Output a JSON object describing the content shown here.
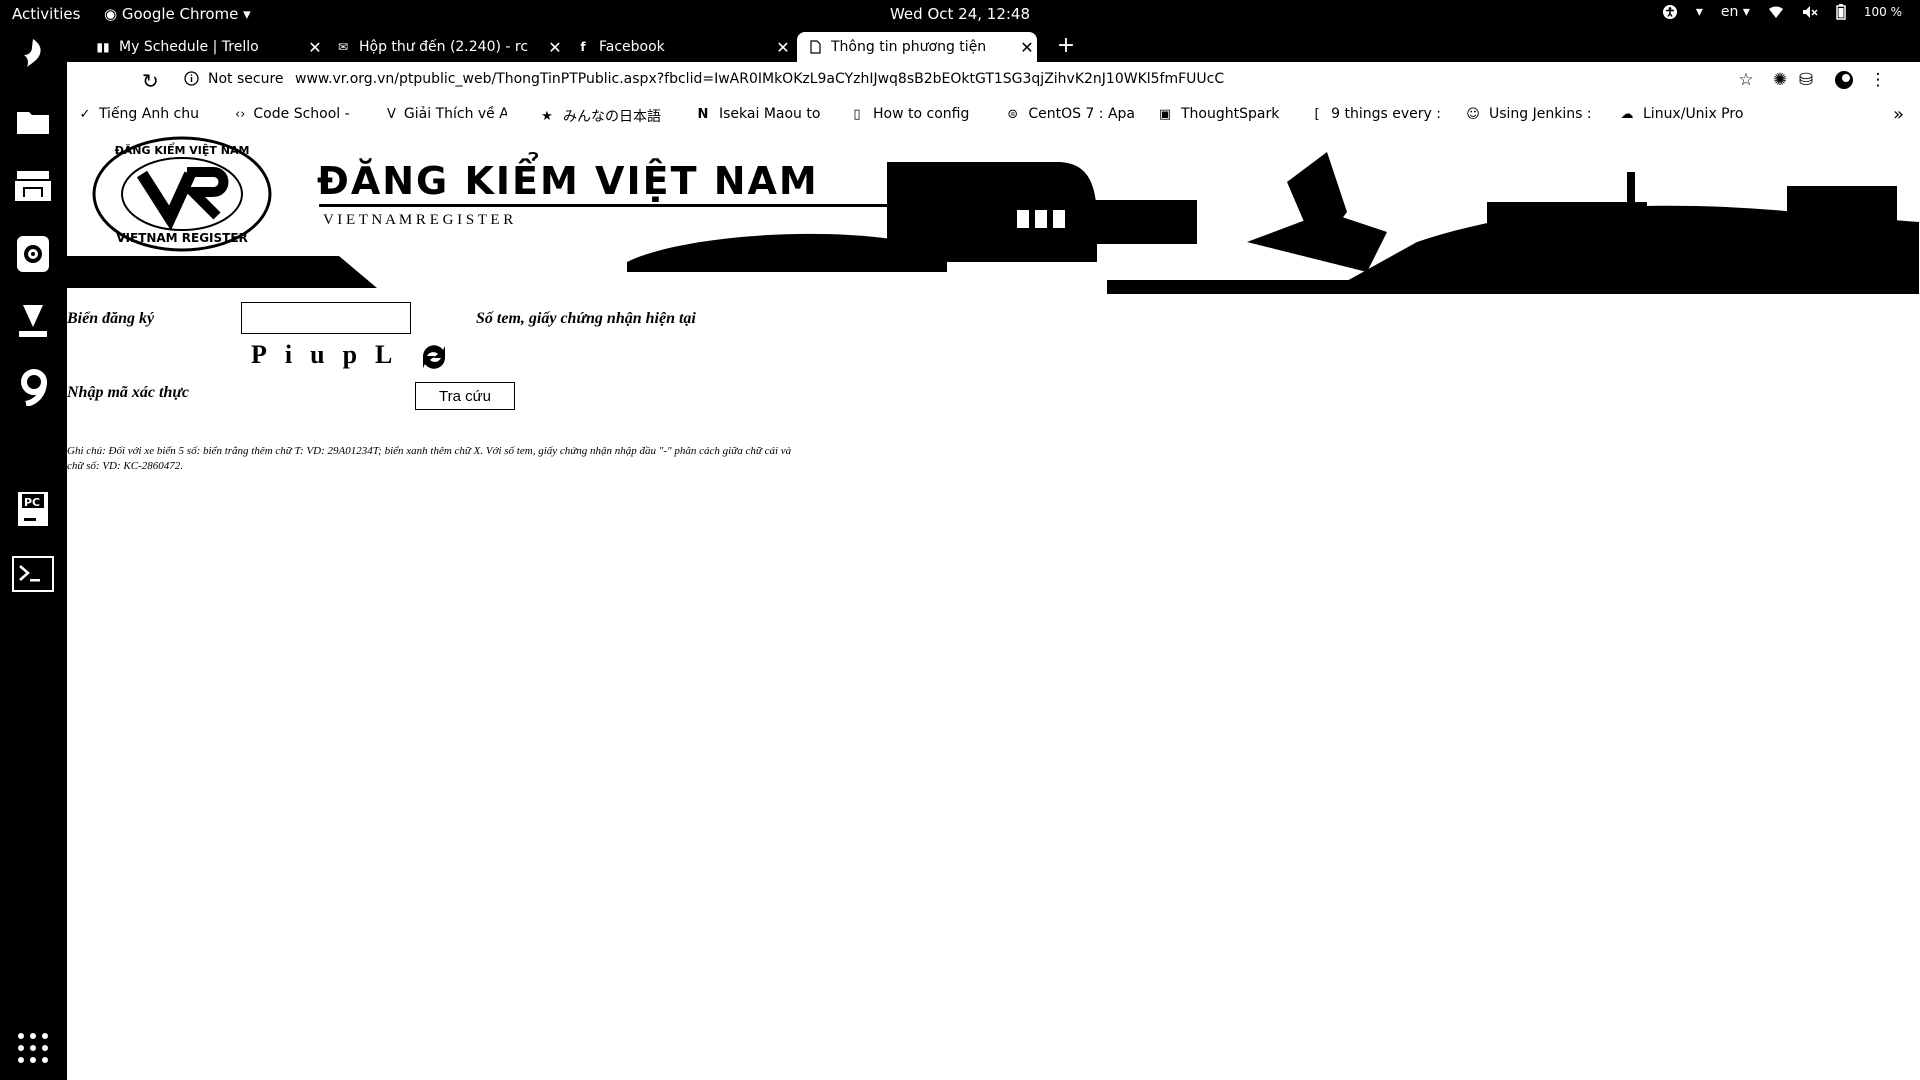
{
  "topbar": {
    "activities": "Activities",
    "app_menu": "Google Chrome",
    "clock": "Wed Oct 24, 12:48",
    "language": "en",
    "battery": "100 %"
  },
  "tabs": [
    {
      "title": "My Schedule | Trello",
      "icon": "trello-icon"
    },
    {
      "title": "Hộp thư đến (2.240) - rc",
      "icon": "mail-icon"
    },
    {
      "title": "Facebook",
      "icon": "facebook-icon"
    },
    {
      "title": "Thông tin phương tiện",
      "icon": "page-icon",
      "active": true
    }
  ],
  "toolbar": {
    "security": "Not secure",
    "url": "www.vr.org.vn/ptpublic_web/ThongTinPTPublic.aspx?fbclid=IwAR0IMkOKzL9aCYzhIJwq8sB2bEOktGT1SG3qjZihvK2nJ10WKl5fmFUUcC"
  },
  "bookmarks": [
    "Tiếng Anh chu",
    "Code School - C",
    "Giải Thích về A",
    "みんなの日本語",
    "Isekai Maou to",
    "How to config",
    "CentOS 7 : Apa",
    "ThoughtSpark",
    "9 things every :",
    "Using Jenkins :",
    "Linux/Unix Pro"
  ],
  "bookmarks_more": "»",
  "banner": {
    "logo_text_top": "ĐĂNG KIỂM VIỆT NAM",
    "logo_text_bottom": "VIETNAM REGISTER",
    "logo_mark": "VR",
    "title": "ĐĂNG KIỂM VIỆT NAM",
    "subtitle": "V I E T N A M R E G I S T E R"
  },
  "form": {
    "plate_label": "Biển đăng ký",
    "plate_value": "",
    "sticker_label": "Số tem, giấy chứng nhận hiện tại",
    "captcha_text": "PiupL",
    "captcha_label": "Nhập mã xác thực",
    "search_button": "Tra cứu",
    "note": "Ghi chú: Đối với xe biển 5 số: biển trắng thêm chữ T: VD: 29A01234T; biển xanh thêm chữ X. Với số tem, giấy chứng nhận nhập đầu \"-\" phân cách giữa chữ cái và chữ số: VD: KC-2860472."
  }
}
